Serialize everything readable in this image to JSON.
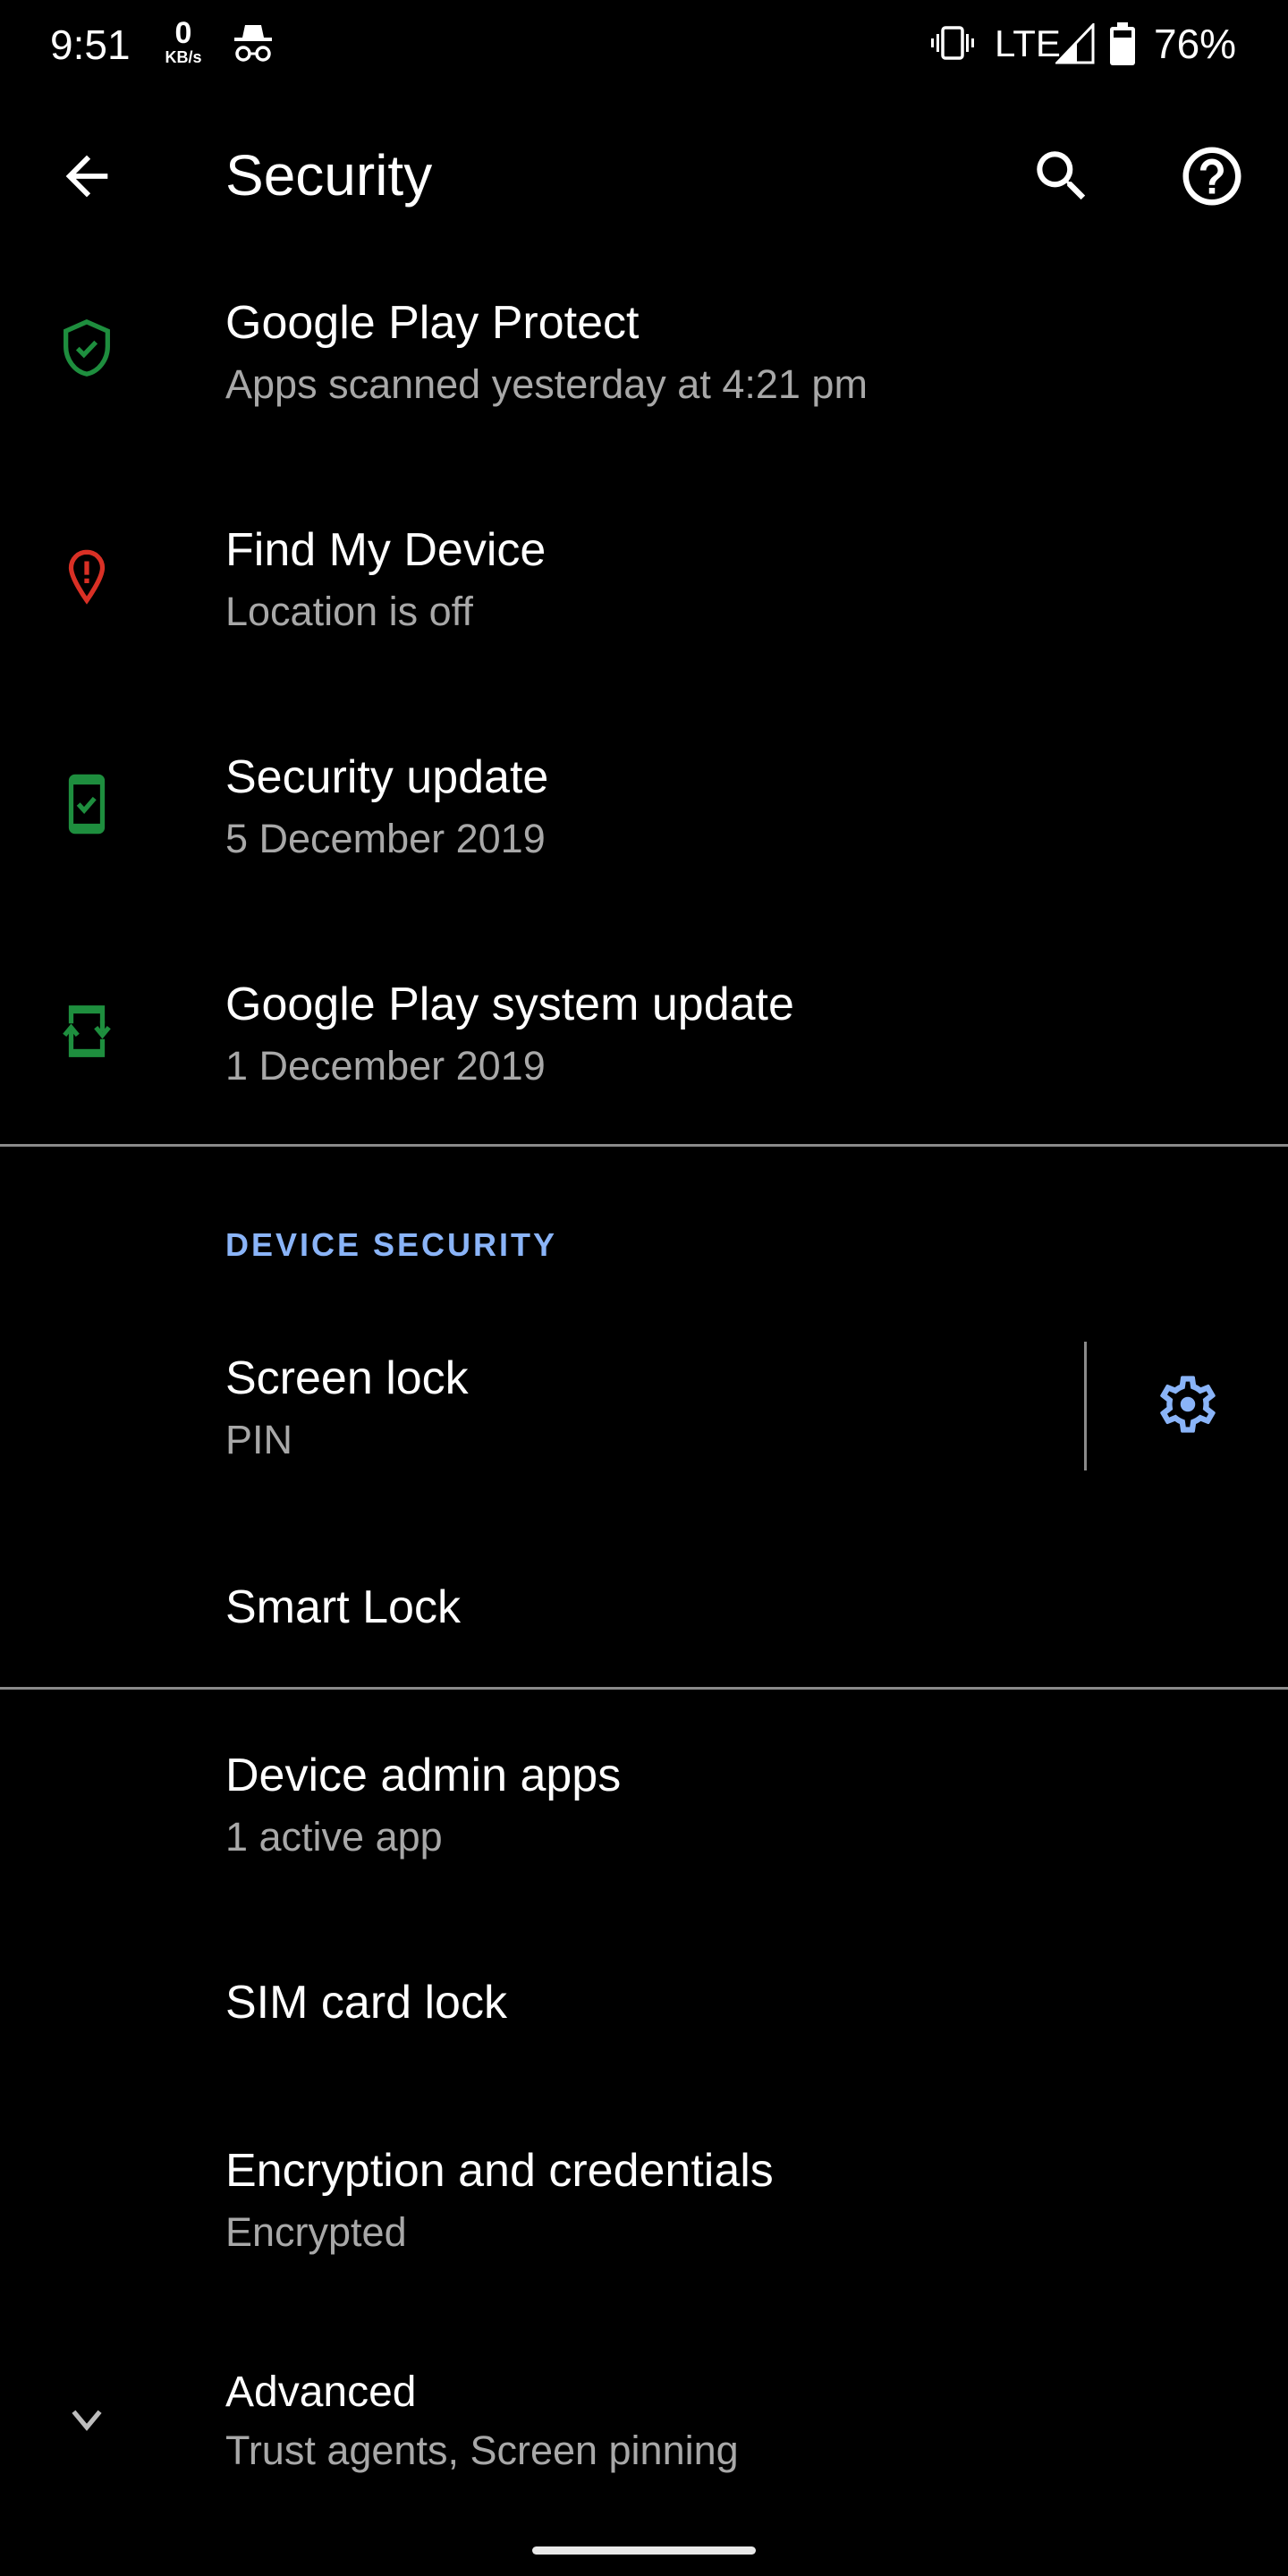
{
  "status_bar": {
    "time": "9:51",
    "net_speed_value": "0",
    "net_speed_unit": "KB/s",
    "network_type": "LTE",
    "battery_percent": "76%",
    "icons": [
      "incognito-icon",
      "vibrate-icon",
      "signal-icon",
      "battery-icon"
    ]
  },
  "toolbar": {
    "title": "Security",
    "back_icon": "arrow-back-icon",
    "search_icon": "search-icon",
    "help_icon": "help-icon"
  },
  "status_items": [
    {
      "title": "Google Play Protect",
      "subtitle": "Apps scanned yesterday at 4:21 pm",
      "icon": "shield-check-icon",
      "icon_color": "#1e8e3e"
    },
    {
      "title": "Find My Device",
      "subtitle": "Location is off",
      "icon": "location-alert-icon",
      "icon_color": "#d93025"
    },
    {
      "title": "Security update",
      "subtitle": "5 December 2019",
      "icon": "phone-check-icon",
      "icon_color": "#1e8e3e"
    },
    {
      "title": "Google Play system update",
      "subtitle": "1 December 2019",
      "icon": "phone-update-icon",
      "icon_color": "#1e8e3e"
    }
  ],
  "device_security": {
    "header": "DEVICE SECURITY",
    "header_color": "#8ab4f8",
    "screen_lock": {
      "title": "Screen lock",
      "subtitle": "PIN",
      "settings_icon": "gear-icon",
      "icon_color": "#8ab4f8"
    },
    "smart_lock": {
      "title": "Smart Lock"
    }
  },
  "other_items": [
    {
      "title": "Device admin apps",
      "subtitle": "1 active app"
    },
    {
      "title": "SIM card lock",
      "subtitle": ""
    },
    {
      "title": "Encryption and credentials",
      "subtitle": "Encrypted"
    }
  ],
  "advanced": {
    "title": "Advanced",
    "subtitle": "Trust agents, Screen pinning",
    "icon": "chevron-down-icon"
  }
}
